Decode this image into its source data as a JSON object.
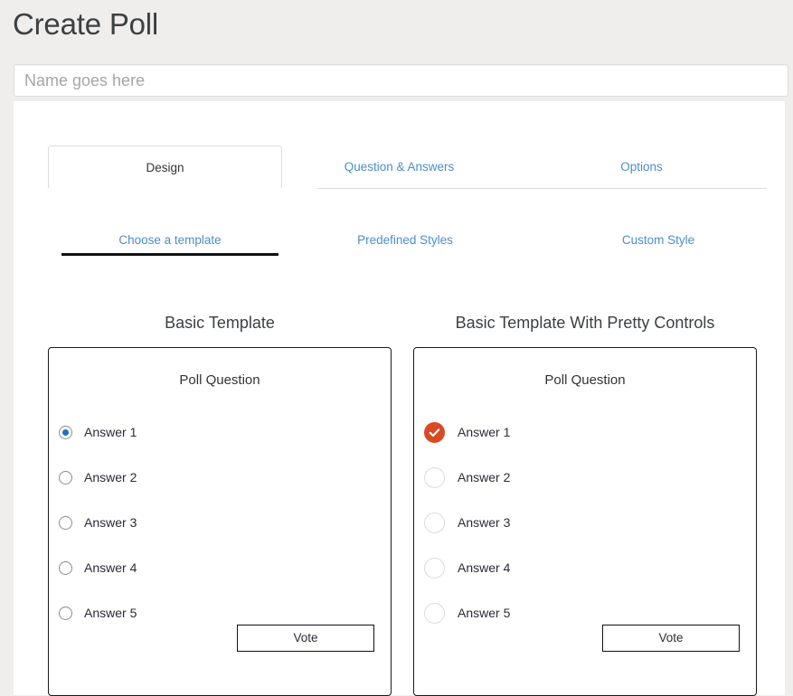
{
  "header": {
    "title": "Create Poll",
    "name_input": {
      "value": "",
      "placeholder": "Name goes here"
    }
  },
  "tabs_primary": [
    {
      "label": "Design",
      "active": true
    },
    {
      "label": "Question & Answers",
      "active": false
    },
    {
      "label": "Options",
      "active": false
    }
  ],
  "tabs_secondary": [
    {
      "label": "Choose a template",
      "active": true
    },
    {
      "label": "Predefined Styles",
      "active": false
    },
    {
      "label": "Custom Style",
      "active": false
    }
  ],
  "templates": [
    {
      "title": "Basic Template",
      "question": "Poll Question",
      "control_style": "native-radio",
      "answers": [
        {
          "label": "Answer 1",
          "selected": true
        },
        {
          "label": "Answer 2",
          "selected": false
        },
        {
          "label": "Answer 3",
          "selected": false
        },
        {
          "label": "Answer 4",
          "selected": false
        },
        {
          "label": "Answer 5",
          "selected": false
        }
      ],
      "vote_label": "Vote"
    },
    {
      "title": "Basic Template With Pretty Controls",
      "question": "Poll Question",
      "control_style": "pretty-radio",
      "answers": [
        {
          "label": "Answer 1",
          "selected": true
        },
        {
          "label": "Answer 2",
          "selected": false
        },
        {
          "label": "Answer 3",
          "selected": false
        },
        {
          "label": "Answer 4",
          "selected": false
        },
        {
          "label": "Answer 5",
          "selected": false
        }
      ],
      "vote_label": "Vote"
    }
  ],
  "colors": {
    "page_background": "#efeeed",
    "panel_background": "#ffffff",
    "link_blue": "#4b8ec9",
    "selected_radio_blue": "#1c72c4",
    "pretty_accent_orange": "#d94a22",
    "card_border": "#1a1a1a",
    "text_dark": "#3c4043"
  }
}
